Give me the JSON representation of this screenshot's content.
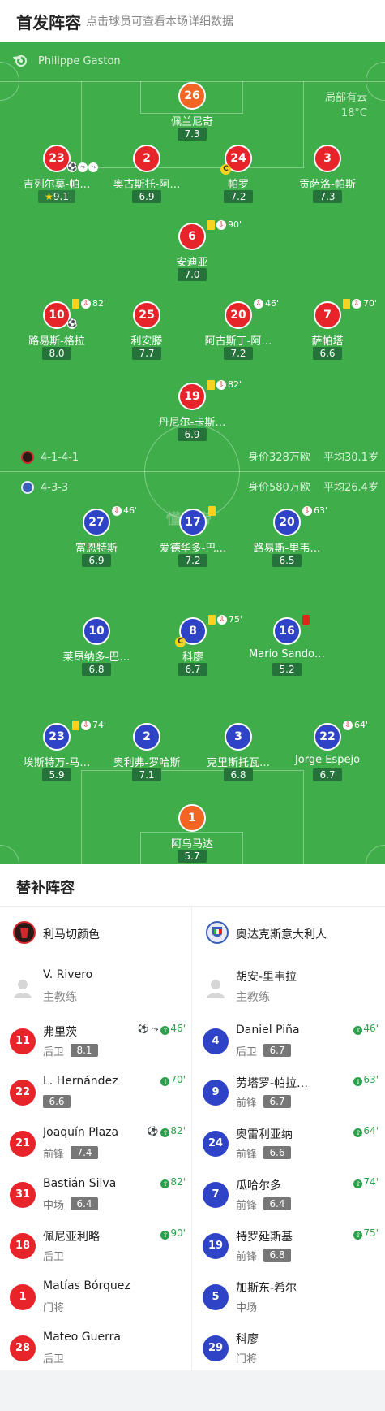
{
  "header": {
    "title": "首发阵容",
    "subtitle": "点击球员可查看本场详细数据"
  },
  "referee": {
    "name": "Philippe Gaston"
  },
  "weather": {
    "condition": "局部有云",
    "temp": "18°C"
  },
  "watermark": "懂球帝",
  "home": {
    "formation": "4-1-4-1",
    "value": "身价328万欧",
    "age": "平均30.1岁",
    "players": [
      {
        "num": "26",
        "name": "佩兰尼奇",
        "rating": "7.3"
      },
      {
        "num": "23",
        "name": "吉列尔莫-帕…",
        "rating": "9.1"
      },
      {
        "num": "2",
        "name": "奥古斯托-阿…",
        "rating": "6.9"
      },
      {
        "num": "24",
        "name": "帕罗",
        "rating": "7.2"
      },
      {
        "num": "3",
        "name": "贡萨洛-帕斯",
        "rating": "7.3"
      },
      {
        "num": "6",
        "name": "安迪亚",
        "rating": "7.0",
        "event_min": "90'"
      },
      {
        "num": "10",
        "name": "路易斯-格拉",
        "rating": "8.0",
        "event_min": "82'"
      },
      {
        "num": "25",
        "name": "利安滕",
        "rating": "7.7"
      },
      {
        "num": "20",
        "name": "阿古斯丁-阿…",
        "rating": "7.2",
        "event_min": "46'"
      },
      {
        "num": "7",
        "name": "萨帕塔",
        "rating": "6.6",
        "event_min": "70'"
      },
      {
        "num": "19",
        "name": "丹尼尔-卡斯…",
        "rating": "6.9",
        "event_min": "82'"
      }
    ]
  },
  "away": {
    "formation": "4-3-3",
    "value": "身价580万欧",
    "age": "平均26.4岁",
    "players": [
      {
        "num": "27",
        "name": "富恩特斯",
        "rating": "6.9",
        "event_min": "46'"
      },
      {
        "num": "17",
        "name": "爱德华多-巴…",
        "rating": "7.2"
      },
      {
        "num": "20",
        "name": "路易斯-里韦…",
        "rating": "6.5",
        "event_min": "63'"
      },
      {
        "num": "10",
        "name": "莱昂纳多-巴…",
        "rating": "6.8"
      },
      {
        "num": "8",
        "name": "科廖",
        "rating": "6.7",
        "event_min": "75'"
      },
      {
        "num": "16",
        "name": "Mario Sando…",
        "rating": "5.2"
      },
      {
        "num": "23",
        "name": "埃斯特万-马…",
        "rating": "5.9",
        "event_min": "74'"
      },
      {
        "num": "2",
        "name": "奥利弗-罗哈斯",
        "rating": "7.1"
      },
      {
        "num": "3",
        "name": "克里斯托瓦…",
        "rating": "6.8"
      },
      {
        "num": "22",
        "name": "Jorge Espejo",
        "rating": "6.7",
        "event_min": "64'"
      },
      {
        "num": "1",
        "name": "阿乌马达",
        "rating": "5.7"
      }
    ]
  },
  "subs_section": {
    "title": "替补阵容"
  },
  "subs_left": {
    "team": "利马切颜色",
    "coach": {
      "name": "V. Rivero",
      "role": "主教练"
    },
    "rows": [
      {
        "num": "11",
        "name": "弗里茨",
        "pos": "后卫",
        "rating": "8.1",
        "min": "46'"
      },
      {
        "num": "22",
        "name": "L. Hernández",
        "pos": "",
        "rating": "6.6",
        "min": "70'"
      },
      {
        "num": "21",
        "name": "Joaquín Plaza",
        "pos": "前锋",
        "rating": "7.4",
        "min": "82'"
      },
      {
        "num": "31",
        "name": "Bastián Silva",
        "pos": "中场",
        "rating": "6.4",
        "min": "82'"
      },
      {
        "num": "18",
        "name": "佩尼亚利略",
        "pos": "后卫",
        "rating": "",
        "min": "90'"
      },
      {
        "num": "1",
        "name": "Matías Bórquez",
        "pos": "门将",
        "rating": "",
        "min": ""
      },
      {
        "num": "28",
        "name": "Mateo Guerra",
        "pos": "后卫",
        "rating": "",
        "min": ""
      }
    ]
  },
  "subs_right": {
    "team": "奥达克斯意大利人",
    "coach": {
      "name": "胡安-里韦拉",
      "role": "主教练"
    },
    "rows": [
      {
        "num": "4",
        "name": "Daniel Piña",
        "pos": "后卫",
        "rating": "6.7",
        "min": "46'"
      },
      {
        "num": "9",
        "name": "劳塔罗-帕拉…",
        "pos": "前锋",
        "rating": "6.7",
        "min": "63'"
      },
      {
        "num": "24",
        "name": "奥雷利亚纳",
        "pos": "前锋",
        "rating": "6.6",
        "min": "64'"
      },
      {
        "num": "7",
        "name": "瓜哈尔多",
        "pos": "前锋",
        "rating": "6.4",
        "min": "74'"
      },
      {
        "num": "19",
        "name": "特罗延斯基",
        "pos": "前锋",
        "rating": "6.8",
        "min": "75'"
      },
      {
        "num": "5",
        "name": "加斯东-希尔",
        "pos": "中场",
        "rating": "",
        "min": ""
      },
      {
        "num": "29",
        "name": "科廖",
        "pos": "门将",
        "rating": "",
        "min": ""
      }
    ]
  },
  "colors": {
    "pitch": "#3fae4a",
    "home": "#e8242b",
    "away": "#2f43c7",
    "gk_home": "#f26522",
    "sub_in": "#2aa14b"
  }
}
